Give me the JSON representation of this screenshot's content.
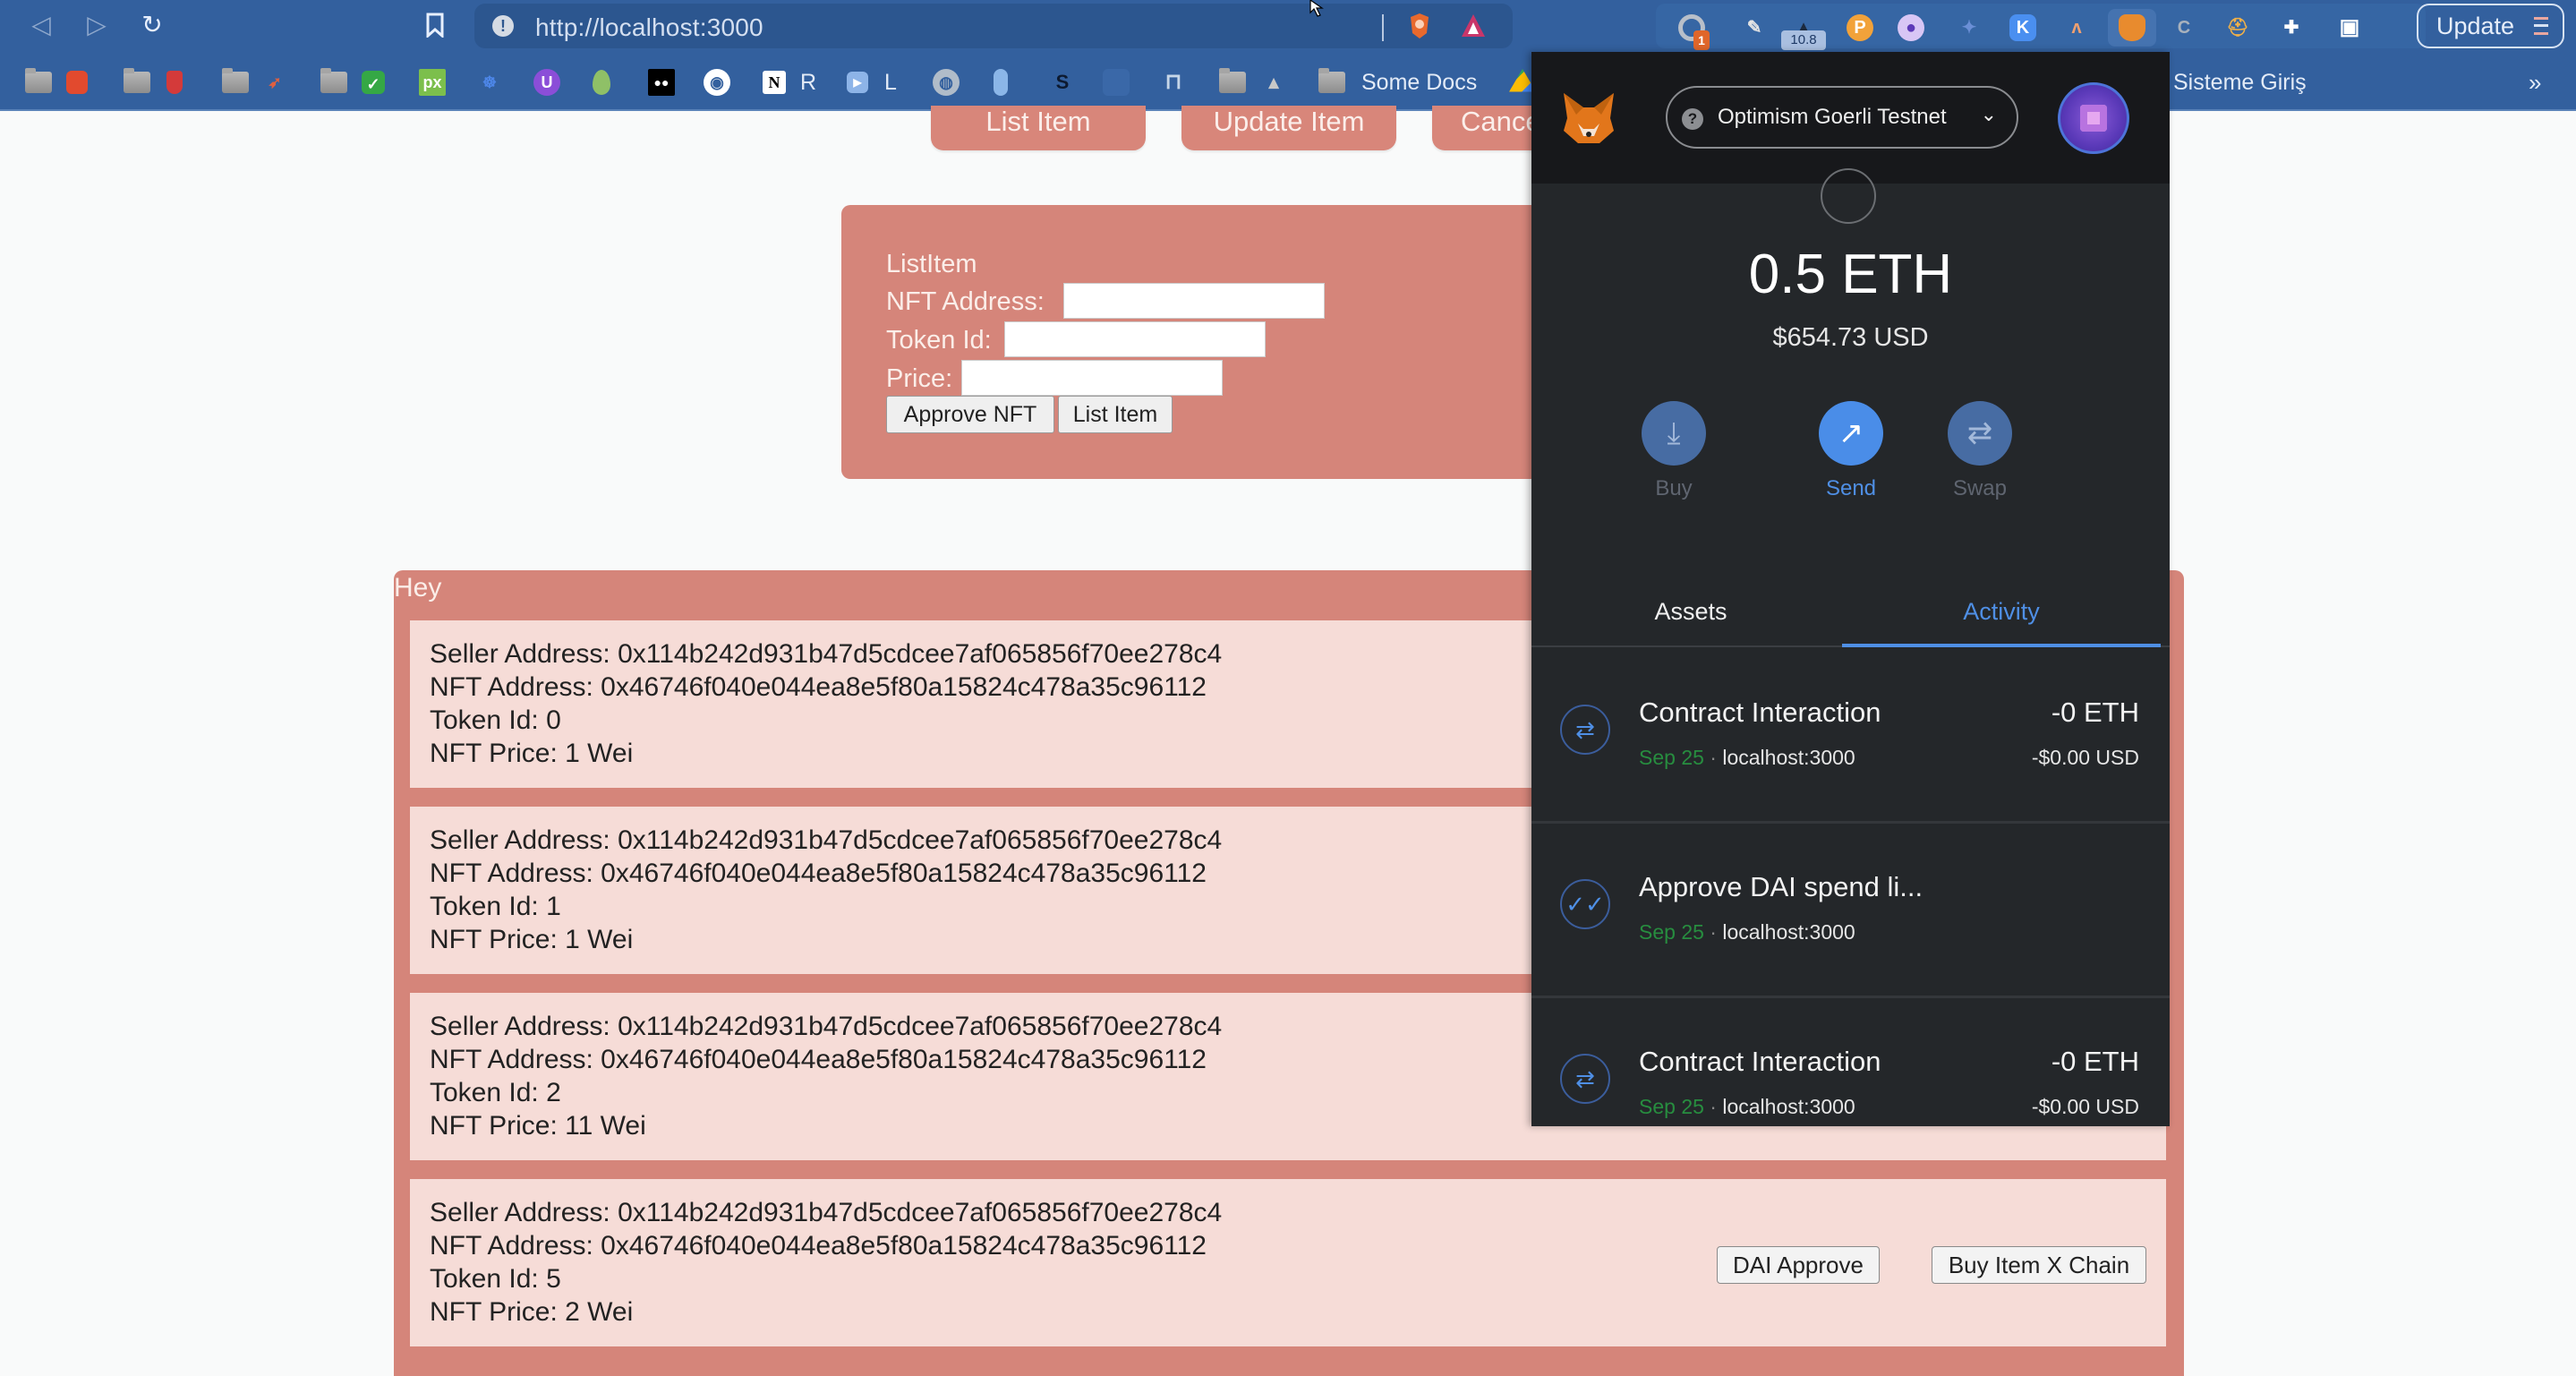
{
  "browser": {
    "url": "http://localhost:3000",
    "update_label": "Update",
    "bookmarks": [
      {
        "label": "",
        "icon": "folder-icon"
      },
      {
        "label": "",
        "icon": "red-app-icon"
      },
      {
        "label": "",
        "icon": "folder-icon"
      },
      {
        "label": "",
        "icon": "pin-icon"
      },
      {
        "label": "",
        "icon": "folder-icon"
      },
      {
        "label": "",
        "icon": "rocket-icon"
      },
      {
        "label": "",
        "icon": "folder-icon"
      },
      {
        "label": "",
        "icon": "checkmark-app-icon"
      },
      {
        "label": "",
        "icon": "px-icon"
      },
      {
        "label": "",
        "icon": "robot-icon"
      },
      {
        "label": "",
        "icon": "u-circle-icon"
      },
      {
        "label": "",
        "icon": "drop-icon"
      },
      {
        "label": "",
        "icon": "medium-icon"
      },
      {
        "label": "",
        "icon": "github-icon"
      },
      {
        "label": "R",
        "icon": "notion-icon"
      },
      {
        "label": "L",
        "icon": "play-icon"
      },
      {
        "label": "",
        "icon": "globe-icon"
      },
      {
        "label": "",
        "icon": "feather-icon"
      },
      {
        "label": "",
        "icon": "s-icon"
      },
      {
        "label": "",
        "icon": "blank-icon"
      },
      {
        "label": "",
        "icon": "crane-icon"
      },
      {
        "label": "",
        "icon": "folder-icon"
      },
      {
        "label": "",
        "icon": "a-icon"
      },
      {
        "label": "Some Docs",
        "icon": "folder-icon"
      },
      {
        "label": "",
        "icon": "google-drive-icon"
      },
      {
        "label": "Sisteme Giriş",
        "icon": ""
      }
    ],
    "extensions": {
      "badge_1": "1",
      "badge_2": "10.8"
    }
  },
  "page": {
    "top_buttons": [
      "List Item",
      "Update Item",
      "Cancel"
    ],
    "list_form": {
      "title": "ListItem",
      "nft_address_label": "NFT Address:",
      "token_id_label": "Token Id:",
      "price_label": "Price:",
      "nft_address_value": "",
      "token_id_value": "",
      "price_value": "",
      "approve_button": "Approve NFT",
      "list_button": "List Item"
    },
    "listings_title": "Hey",
    "listings": [
      {
        "seller": "Seller Address: 0x114b242d931b47d5cdcee7af065856f70ee278c4",
        "nft": "NFT Address: 0x46746f040e044ea8e5f80a15824c478a35c96112",
        "token": "Token Id: 0",
        "price": "NFT Price: 1 Wei"
      },
      {
        "seller": "Seller Address: 0x114b242d931b47d5cdcee7af065856f70ee278c4",
        "nft": "NFT Address: 0x46746f040e044ea8e5f80a15824c478a35c96112",
        "token": "Token Id: 1",
        "price": "NFT Price: 1 Wei"
      },
      {
        "seller": "Seller Address: 0x114b242d931b47d5cdcee7af065856f70ee278c4",
        "nft": "NFT Address: 0x46746f040e044ea8e5f80a15824c478a35c96112",
        "token": "Token Id: 2",
        "price": "NFT Price: 11 Wei"
      },
      {
        "seller": "Seller Address: 0x114b242d931b47d5cdcee7af065856f70ee278c4",
        "nft": "NFT Address: 0x46746f040e044ea8e5f80a15824c478a35c96112",
        "token": "Token Id: 5",
        "price": "NFT Price: 2 Wei",
        "dai_approve": "DAI Approve",
        "buy_x_chain": "Buy Item X Chain"
      }
    ]
  },
  "metamask": {
    "network": "Optimism Goerli Testnet",
    "balance": "0.5 ETH",
    "balance_usd": "$654.73 USD",
    "actions": [
      "Buy",
      "Send",
      "Swap"
    ],
    "tabs": [
      "Assets",
      "Activity"
    ],
    "active_tab": "Activity",
    "transactions": [
      {
        "title": "Contract Interaction",
        "date": "Sep 25",
        "origin": "localhost:3000",
        "amount": "-0 ETH",
        "fiat": "-$0.00 USD",
        "icon": "swap-arrows-icon"
      },
      {
        "title": "Approve DAI spend li...",
        "date": "Sep 25",
        "origin": "localhost:3000",
        "amount": "",
        "fiat": "",
        "icon": "double-check-icon"
      },
      {
        "title": "Contract Interaction",
        "date": "Sep 25",
        "origin": "localhost:3000",
        "amount": "-0 ETH",
        "fiat": "-$0.00 USD",
        "icon": "swap-arrows-icon"
      }
    ]
  },
  "colors": {
    "browser_chrome": "#33609e",
    "panel_salmon": "#d5857a",
    "card_pink": "#f6dcd7",
    "metamask_bg": "#24272a",
    "metamask_accent": "#4f8fe5"
  }
}
